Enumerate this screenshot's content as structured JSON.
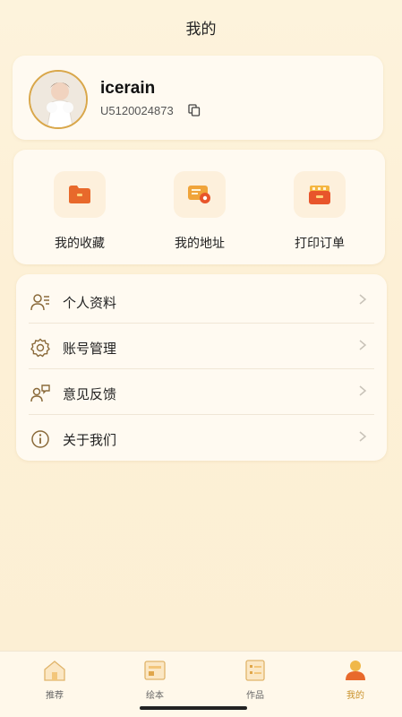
{
  "header": {
    "title": "我的"
  },
  "profile": {
    "username": "icerain",
    "user_id": "U5120024873"
  },
  "shortcuts": [
    {
      "label": "我的收藏",
      "icon": "folder-icon"
    },
    {
      "label": "我的地址",
      "icon": "address-icon"
    },
    {
      "label": "打印订单",
      "icon": "order-icon"
    }
  ],
  "menu": [
    {
      "label": "个人资料",
      "icon": "profile-icon"
    },
    {
      "label": "账号管理",
      "icon": "gear-icon"
    },
    {
      "label": "意见反馈",
      "icon": "feedback-icon"
    },
    {
      "label": "关于我们",
      "icon": "info-icon"
    }
  ],
  "tabbar": [
    {
      "label": "推荐",
      "icon": "home-icon",
      "active": false
    },
    {
      "label": "绘本",
      "icon": "picture-book-icon",
      "active": false
    },
    {
      "label": "作品",
      "icon": "works-icon",
      "active": false
    },
    {
      "label": "我的",
      "icon": "user-icon",
      "active": true
    }
  ],
  "colors": {
    "accent": "#d9892a",
    "accent_light": "#f0b84a",
    "background": "#fdf3dc"
  }
}
